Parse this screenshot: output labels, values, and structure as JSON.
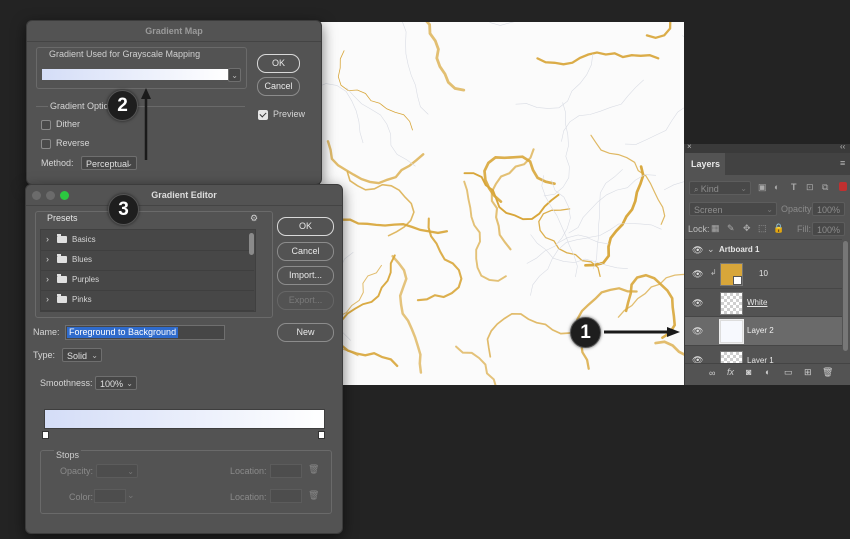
{
  "gradient_map": {
    "title": "Gradient Map",
    "group_label": "Gradient Used for Grayscale Mapping",
    "ok": "OK",
    "cancel": "Cancel",
    "preview": "Preview",
    "preview_checked": true,
    "options_label": "Gradient Optio",
    "dither": "Dither",
    "reverse": "Reverse",
    "method_label": "Method:",
    "method_value": "Perceptual"
  },
  "gradient_editor": {
    "title": "Gradient Editor",
    "presets_label": "Presets",
    "presets": [
      "Basics",
      "Blues",
      "Purples",
      "Pinks"
    ],
    "ok": "OK",
    "cancel": "Cancel",
    "import": "Import...",
    "export": "Export...",
    "name_label": "Name:",
    "name_value": "Foreground to Background",
    "new": "New",
    "type_label": "Type:",
    "type_value": "Solid",
    "smoothness_label": "Smoothness:",
    "smoothness_value": "100%",
    "stops_label": "Stops",
    "opacity_label": "Opacity:",
    "color_label": "Color:",
    "location_label": "Location:",
    "gradient_start": "#d4ddf7",
    "gradient_end": "#ffffff"
  },
  "layers_panel": {
    "tab": "Layers",
    "filter_kind": "Kind",
    "blend_mode": "Screen",
    "opacity_label": "Opacity:",
    "opacity_value": "100%",
    "lock_label": "Lock:",
    "fill_label": "Fill:",
    "fill_value": "100%",
    "artboard": "Artboard 1",
    "layers": [
      {
        "name": "10"
      },
      {
        "name": "White"
      },
      {
        "name": "Layer 2"
      },
      {
        "name": "Layer 1"
      }
    ]
  },
  "callouts": [
    "1",
    "2",
    "3"
  ],
  "colors": {
    "accent_gold": "#d8a63a",
    "selected_name_bg": "#2f6bcc",
    "dialog_bg": "#535353"
  }
}
